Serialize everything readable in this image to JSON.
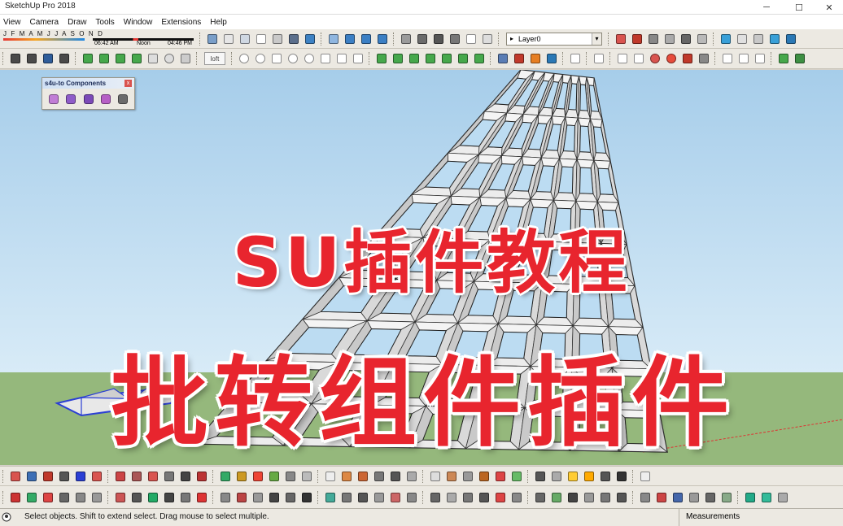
{
  "window": {
    "title": "SketchUp Pro 2018",
    "controls": [
      "─",
      "☐",
      "✕"
    ]
  },
  "menu": [
    "View",
    "Camera",
    "Draw",
    "Tools",
    "Window",
    "Extensions",
    "Help"
  ],
  "shadow_settings": {
    "months": "J F M A M J J A S O N D",
    "time_start": "06:42 AM",
    "time_mid": "Noon",
    "time_end": "04:46 PM"
  },
  "layer": {
    "current": "Layer0"
  },
  "loft_button": "loft",
  "components_panel": {
    "title": "s4u-to Components",
    "close": "x",
    "icons": [
      "convert-to-component-icon",
      "explode-icon",
      "select-icon",
      "replace-icon",
      "settings-icon"
    ]
  },
  "overlay": {
    "line1": "SU插件教程",
    "line2": "批转组件插件"
  },
  "status": {
    "message": "Select objects. Shift to extend select. Drag mouse to select multiple.",
    "measurements_label": "Measurements"
  },
  "colors": {
    "sky": "#b9daf2",
    "ground": "#95b87c",
    "overlay_text": "#e8252e",
    "selection": "#2b3fd4"
  }
}
